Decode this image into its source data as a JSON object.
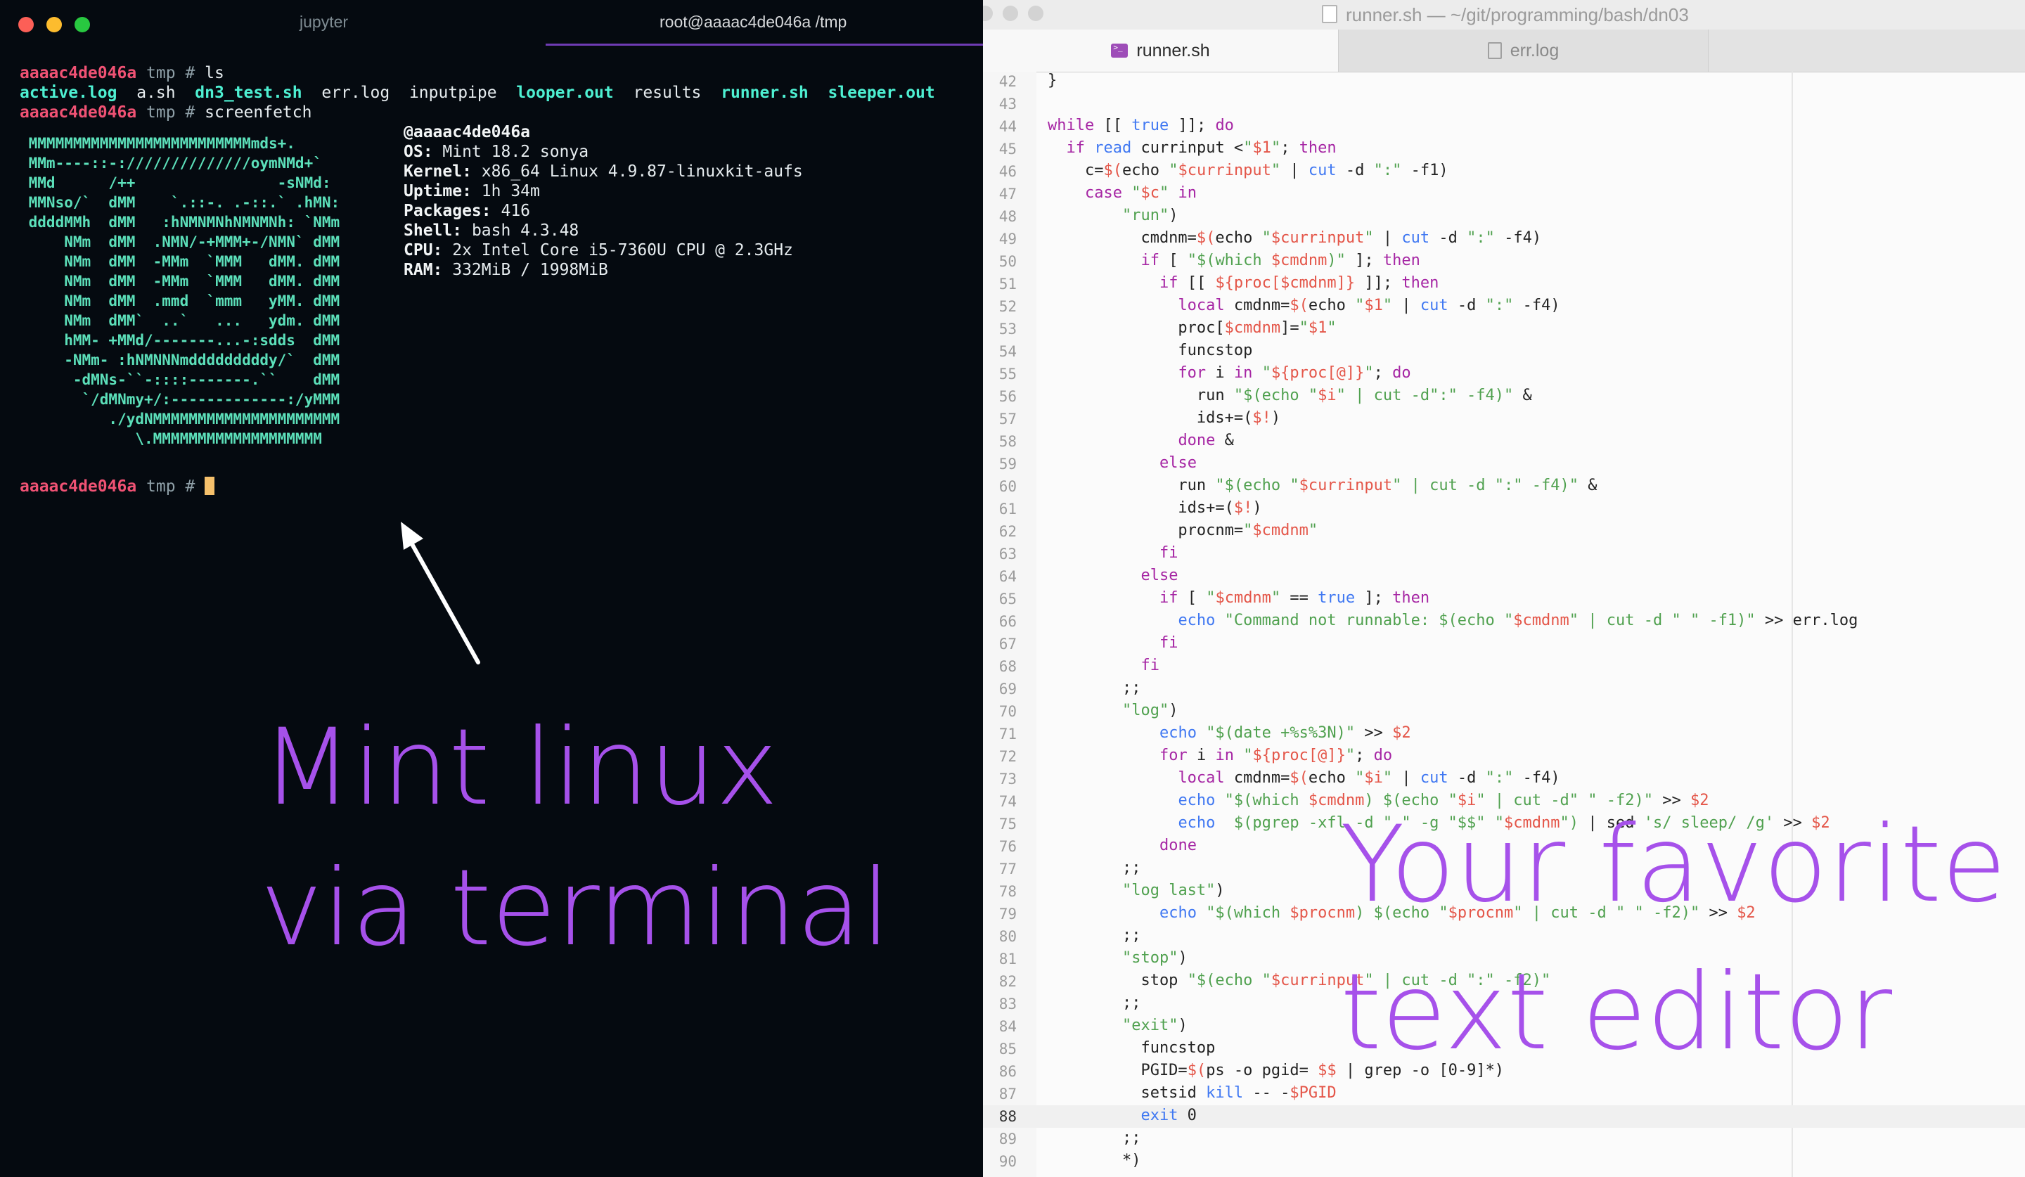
{
  "terminal": {
    "tabs": [
      "jupyter",
      "root@aaaac4de046a /tmp"
    ],
    "prompt": {
      "host": "aaaac4de046a",
      "dir": "tmp",
      "symbol": "#"
    },
    "commands": [
      "ls",
      "screenfetch"
    ],
    "ls_output": [
      {
        "name": "active.log",
        "kind": "exe"
      },
      {
        "name": "a.sh",
        "kind": "plain"
      },
      {
        "name": "dn3_test.sh",
        "kind": "exe"
      },
      {
        "name": "err.log",
        "kind": "plain"
      },
      {
        "name": "inputpipe",
        "kind": "plain"
      },
      {
        "name": "looper.out",
        "kind": "exe"
      },
      {
        "name": "results",
        "kind": "plain"
      },
      {
        "name": "runner.sh",
        "kind": "exe"
      },
      {
        "name": "sleeper.out",
        "kind": "exe"
      }
    ],
    "ascii_logo": [
      " MMMMMMMMMMMMMMMMMMMMMMMMMmds+.",
      " MMm----::-://////////////oymNMd+`",
      " MMd      /++                -sNMd:",
      " MMNso/`  dMM    `.::-. .-::.` .hMN:",
      " ddddMMh  dMM   :hNMNMNhNMNMNh: `NMm",
      "     NMm  dMM  .NMN/-+MMM+-/NMN` dMM",
      "     NMm  dMM  -MMm  `MMM   dMM. dMM",
      "     NMm  dMM  -MMm  `MMM   dMM. dMM",
      "     NMm  dMM  .mmd  `mmm   yMM. dMM",
      "     NMm  dMM`  ..`   ...   ydm. dMM",
      "     hMM- +MMd/-------...-:sdds  dMM",
      "     -NMm- :hNMNNNmdddddddddy/`  dMM",
      "      -dMNs-``-::::-------.``    dMM",
      "       `/dMNmy+/:-------------:/yMMM",
      "          ./ydNMMMMMMMMMMMMMMMMMMMMM",
      "             \\.MMMMMMMMMMMMMMMMMMM"
    ],
    "sysinfo": {
      "user": "@aaaac4de046a",
      "rows": [
        {
          "label": "OS:",
          "value": " Mint 18.2 sonya"
        },
        {
          "label": "Kernel:",
          "value": " x86_64 Linux 4.9.87-linuxkit-aufs"
        },
        {
          "label": "Uptime:",
          "value": " 1h 34m"
        },
        {
          "label": "Packages:",
          "value": " 416"
        },
        {
          "label": "Shell:",
          "value": " bash 4.3.48"
        },
        {
          "label": "CPU:",
          "value": " 2x Intel Core i5-7360U CPU @ 2.3GHz"
        },
        {
          "label": "RAM:",
          "value": " 332MiB / 1998MiB"
        }
      ]
    },
    "annotation": [
      "Mint linux",
      "via terminal"
    ]
  },
  "editor": {
    "window_title": "runner.sh — ~/git/programming/bash/dn03",
    "tabs": [
      "runner.sh",
      "err.log"
    ],
    "current_line": 88,
    "lines": [
      {
        "n": 42,
        "html": "}"
      },
      {
        "n": 43,
        "html": ""
      },
      {
        "n": 44,
        "html": "<span class='k'>while</span> [[ <span class='b'>true</span> ]]; <span class='k'>do</span>"
      },
      {
        "n": 45,
        "html": "  <span class='k'>if</span> <span class='b'>read</span> currinput &lt;<span class='s'>\"<span class='v'>$1</span>\"</span>; <span class='k'>then</span>"
      },
      {
        "n": 46,
        "html": "    c=<span class='v'>$(</span>echo <span class='s'>\"<span class='v'>$currinput</span>\"</span> | <span class='b'>cut</span> -d <span class='s'>\":\"</span> -f1)"
      },
      {
        "n": 47,
        "html": "    <span class='k'>case</span> <span class='s'>\"<span class='v'>$c</span>\"</span> <span class='k'>in</span>"
      },
      {
        "n": 48,
        "html": "        <span class='s'>\"run\"</span>)"
      },
      {
        "n": 49,
        "html": "          cmdnm=<span class='v'>$(</span>echo <span class='s'>\"<span class='v'>$currinput</span>\"</span> | <span class='b'>cut</span> -d <span class='s'>\":\"</span> -f4)"
      },
      {
        "n": 50,
        "html": "          <span class='k'>if</span> [ <span class='s'>\"$(which <span class='v'>$cmdnm</span>)\"</span> ]; <span class='k'>then</span>"
      },
      {
        "n": 51,
        "html": "            <span class='k'>if</span> [[ <span class='v'>${proc[$cmdnm]}</span> ]]; <span class='k'>then</span>"
      },
      {
        "n": 52,
        "html": "              <span class='k'>local</span> cmdnm=<span class='v'>$(</span>echo <span class='s'>\"<span class='v'>$1</span>\"</span> | <span class='b'>cut</span> -d <span class='s'>\":\"</span> -f4)"
      },
      {
        "n": 53,
        "html": "              proc[<span class='v'>$cmdnm</span>]=<span class='s'>\"<span class='v'>$1</span>\"</span>"
      },
      {
        "n": 54,
        "html": "              funcstop"
      },
      {
        "n": 55,
        "html": "              <span class='k'>for</span> i <span class='k'>in</span> <span class='s'>\"<span class='v'>${proc[@]}</span>\"</span>; <span class='k'>do</span>"
      },
      {
        "n": 56,
        "html": "                run <span class='s'>\"$(echo \"<span class='v'>$i</span>\" | cut -d\":\" -f4)\"</span> &amp;"
      },
      {
        "n": 57,
        "html": "                ids+=(<span class='v'>$!</span>)"
      },
      {
        "n": 58,
        "html": "              <span class='k'>done</span> &amp;"
      },
      {
        "n": 59,
        "html": "            <span class='k'>else</span>"
      },
      {
        "n": 60,
        "html": "              run <span class='s'>\"$(echo \"<span class='v'>$currinput</span>\" | cut -d \":\" -f4)\"</span> &amp;"
      },
      {
        "n": 61,
        "html": "              ids+=(<span class='v'>$!</span>)"
      },
      {
        "n": 62,
        "html": "              procnm=<span class='s'>\"<span class='v'>$cmdnm</span>\"</span>"
      },
      {
        "n": 63,
        "html": "            <span class='k'>fi</span>"
      },
      {
        "n": 64,
        "html": "          <span class='k'>else</span>"
      },
      {
        "n": 65,
        "html": "            <span class='k'>if</span> [ <span class='s'>\"<span class='v'>$cmdnm</span>\"</span> == <span class='b'>true</span> ]; <span class='k'>then</span>"
      },
      {
        "n": 66,
        "html": "              <span class='b'>echo</span> <span class='s'>\"Command not runnable: $(echo \"<span class='v'>$cmdnm</span>\" | cut -d \" \" -f1)\"</span> &gt;&gt; err.log"
      },
      {
        "n": 67,
        "html": "            <span class='k'>fi</span>"
      },
      {
        "n": 68,
        "html": "          <span class='k'>fi</span>"
      },
      {
        "n": 69,
        "html": "        ;;"
      },
      {
        "n": 70,
        "html": "        <span class='s'>\"log\"</span>)"
      },
      {
        "n": 71,
        "html": "            <span class='b'>echo</span> <span class='s'>\"$(date +%s%3N)\"</span> &gt;&gt; <span class='v'>$2</span>"
      },
      {
        "n": 72,
        "html": "            <span class='k'>for</span> i <span class='k'>in</span> <span class='s'>\"<span class='v'>${proc[@]}</span>\"</span>; <span class='k'>do</span>"
      },
      {
        "n": 73,
        "html": "              <span class='k'>local</span> cmdnm=<span class='v'>$(</span>echo <span class='s'>\"<span class='v'>$i</span>\"</span> | <span class='b'>cut</span> -d <span class='s'>\":\"</span> -f4)"
      },
      {
        "n": 74,
        "html": "              <span class='b'>echo</span> <span class='s'>\"$(which <span class='v'>$cmdnm</span>) $(echo \"<span class='v'>$i</span>\" | cut -d\" \" -f2)\"</span> &gt;&gt; <span class='v'>$2</span>"
      },
      {
        "n": 75,
        "html": "              <span class='b'>echo</span>  <span class='s'>$(pgrep -xfl -d \" \" -g \"$$\" \"<span class='v'>$cmdnm</span>\")</span> | sed <span class='s'>'s/ sleep/ /g'</span> &gt;&gt; <span class='v'>$2</span>"
      },
      {
        "n": 76,
        "html": "            <span class='k'>done</span>"
      },
      {
        "n": 77,
        "html": "        ;;"
      },
      {
        "n": 78,
        "html": "        <span class='s'>\"log last\"</span>)"
      },
      {
        "n": 79,
        "html": "            <span class='b'>echo</span> <span class='s'>\"$(which <span class='v'>$procnm</span>) $(echo \"<span class='v'>$procnm</span>\" | cut -d \" \" -f2)\"</span> &gt;&gt; <span class='v'>$2</span>"
      },
      {
        "n": 80,
        "html": "        ;;"
      },
      {
        "n": 81,
        "html": "        <span class='s'>\"stop\"</span>)"
      },
      {
        "n": 82,
        "html": "          stop <span class='s'>\"$(echo \"<span class='v'>$currinput</span>\" | cut -d \":\" -f2)\"</span>"
      },
      {
        "n": 83,
        "html": "        ;;"
      },
      {
        "n": 84,
        "html": "        <span class='s'>\"exit\"</span>)"
      },
      {
        "n": 85,
        "html": "          funcstop"
      },
      {
        "n": 86,
        "html": "          PGID=<span class='v'>$(</span>ps -o pgid= <span class='v'>$$</span> | grep -o [0-9]*)"
      },
      {
        "n": 87,
        "html": "          setsid <span class='b'>kill</span> -- -<span class='v'>$PGID</span>"
      },
      {
        "n": 88,
        "html": "          <span class='b'>exit</span> 0"
      },
      {
        "n": 89,
        "html": "        ;;"
      },
      {
        "n": 90,
        "html": "        *)"
      }
    ],
    "annotation": [
      "Your favorite",
      "text editor"
    ]
  },
  "colors": {
    "terminal_bg": "#050a10",
    "annotation": "#a651ea",
    "prompt_host": "#f05274",
    "executable": "#4ef0d2"
  }
}
